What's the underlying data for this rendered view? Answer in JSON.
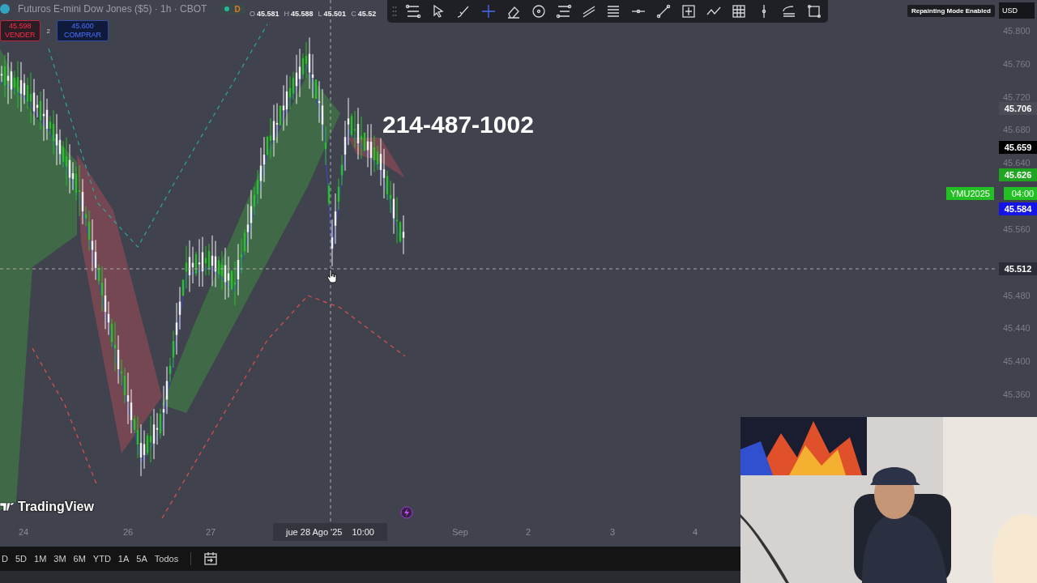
{
  "header": {
    "symbol": "Futuros E-mini Dow Jones ($5) · 1h · CBOT",
    "status_badge": "D",
    "ohlc": [
      {
        "label": "O",
        "value": "45.581"
      },
      {
        "label": "H",
        "value": "45.588"
      },
      {
        "label": "L",
        "value": "45.501"
      },
      {
        "label": "C",
        "value": "45.52"
      }
    ]
  },
  "trade": {
    "sell_price": "45.598",
    "sell_label": "VENDER",
    "quantity": "2",
    "buy_price": "45.600",
    "buy_label": "COMPRAR"
  },
  "overlay_text": "214-487-1002",
  "repaint_badge": "Repainting Mode Enabled",
  "currency": "USD",
  "price_axis": {
    "ticks": [
      "45.800",
      "45.760",
      "45.720",
      "45.680",
      "45.640",
      "45.560",
      "45.480",
      "45.440",
      "45.400",
      "45.360"
    ],
    "labels": [
      {
        "text": "45.706",
        "color": "#4b4d56"
      },
      {
        "text": "45.659",
        "color": "#000000"
      },
      {
        "text": "45.626",
        "color": "#1fa51f"
      },
      {
        "text": "45.584",
        "color": "#1414e6"
      },
      {
        "text": "45.512",
        "color": "#2b2d36"
      }
    ],
    "symbol_badge": {
      "symbol": "YMU2025",
      "countdown": "04:00"
    }
  },
  "time_axis": {
    "labels": [
      "24",
      "26",
      "27",
      "Sep",
      "2",
      "3",
      "4"
    ],
    "crosshair_date": "jue 28 Ago '25",
    "crosshair_time": "10:00"
  },
  "ranges": [
    "D",
    "5D",
    "1M",
    "3M",
    "6M",
    "YTD",
    "1A",
    "5A",
    "Todos"
  ],
  "brand": "TradingView",
  "webcam": {
    "kind": "picture"
  }
}
